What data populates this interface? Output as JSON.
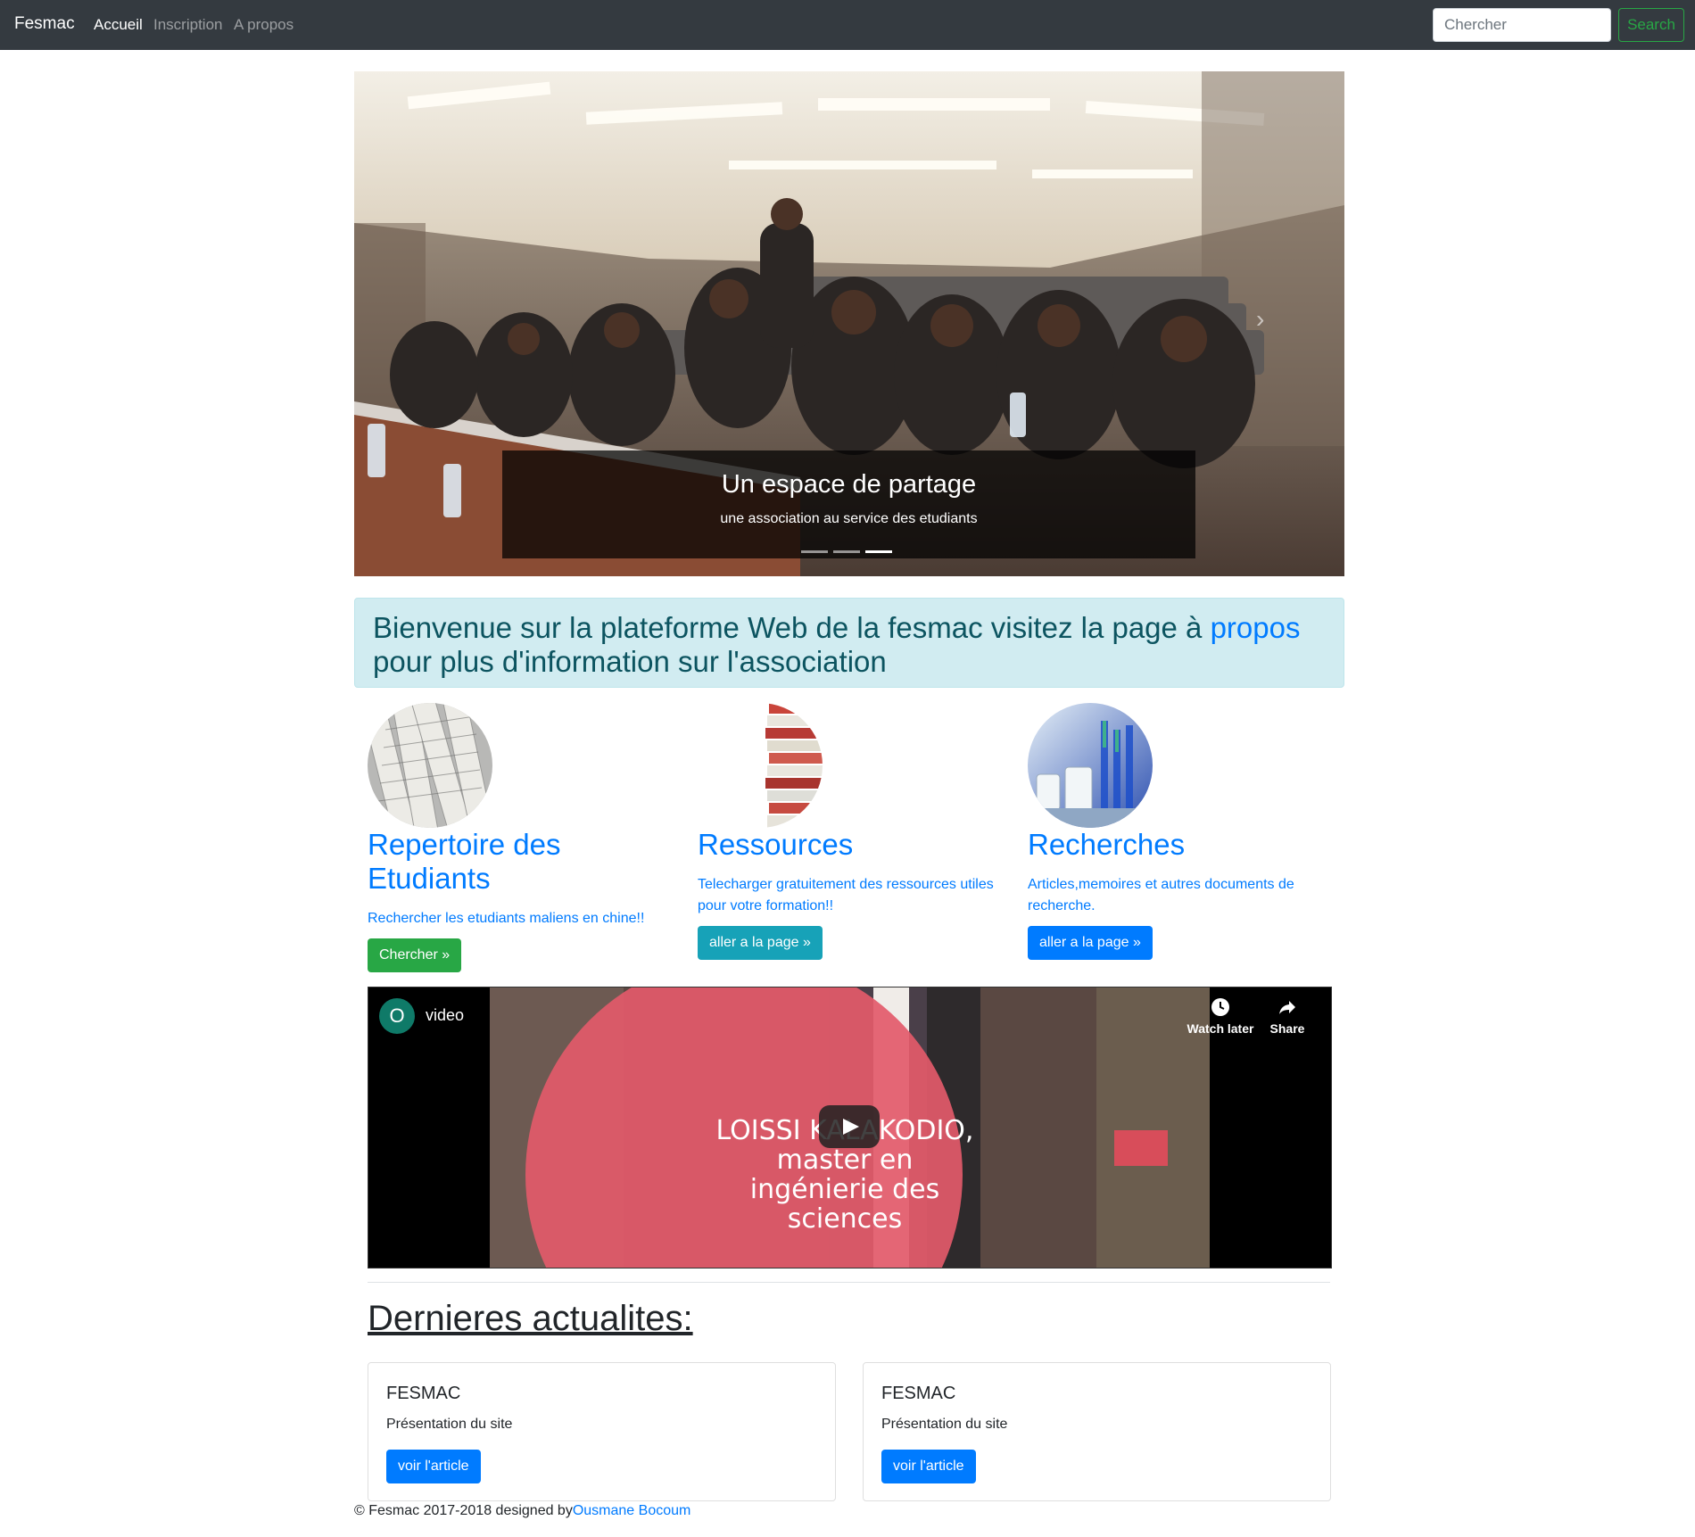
{
  "navbar": {
    "brand": "Fesmac",
    "links": [
      "Accueil",
      "Inscription",
      "A propos"
    ],
    "search_placeholder": "Chercher",
    "search_button": "Search"
  },
  "carousel": {
    "title": "Un espace de partage",
    "subtitle": "une association au service des etudiants",
    "slide_count": 3,
    "active_slide": 3
  },
  "alert": {
    "text_before": "Bienvenue sur la plateforme Web de la fesmac visitez la page à ",
    "link": "propos",
    "text_after": " pour plus d'information sur l'association"
  },
  "features": [
    {
      "title": "Repertoire des Etudiants",
      "text": "Rechercher les etudiants maliens en chine!!",
      "button": "Chercher »"
    },
    {
      "title": "Ressources",
      "text": "Telecharger gratuitement des ressources utiles pour votre formation!!",
      "button": "aller a la page »"
    },
    {
      "title": "Recherches",
      "text": "Articles,memoires et autres documents de recherche.",
      "button": "aller a la page »"
    }
  ],
  "video": {
    "channel_initial": "O",
    "title": "video",
    "watch_later": "Watch later",
    "share": "Share",
    "overlay_text": "LOISSI KALAKODIO, master en ingénierie des sciences"
  },
  "news": {
    "heading": "Dernieres actualites:",
    "cards": [
      {
        "title": "FESMAC",
        "text": "Présentation du site",
        "button": "voir l'article"
      },
      {
        "title": "FESMAC",
        "text": "Présentation du site",
        "button": "voir l'article"
      }
    ]
  },
  "footer": {
    "text": "© Fesmac 2017-2018 designed by",
    "author": "Ousmane Bocoum"
  }
}
